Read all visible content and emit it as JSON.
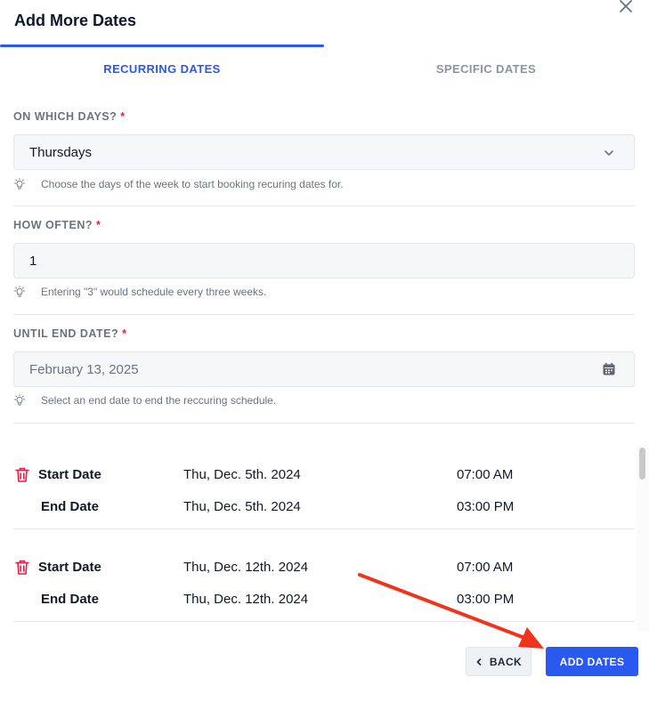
{
  "modal": {
    "title": "Add More Dates"
  },
  "tabs": [
    {
      "label": "RECURRING DATES",
      "active": true
    },
    {
      "label": "SPECIFIC DATES",
      "active": false
    }
  ],
  "form": {
    "days": {
      "label": "ON WHICH DAYS?",
      "required": "*",
      "value": "Thursdays",
      "hint": "Choose the days of the week to start booking recuring dates for."
    },
    "often": {
      "label": "HOW OFTEN?",
      "required": "*",
      "value": "1",
      "hint": "Entering \"3\" would schedule every three weeks."
    },
    "until": {
      "label": "UNTIL END DATE?",
      "required": "*",
      "placeholder": "February 13, 2025",
      "hint": "Select an end date to end the reccuring schedule."
    }
  },
  "dates": [
    {
      "start_label": "Start Date",
      "start_date": "Thu, Dec. 5th. 2024",
      "start_time": "07:00 AM",
      "end_label": "End Date",
      "end_date": "Thu, Dec. 5th. 2024",
      "end_time": "03:00 PM"
    },
    {
      "start_label": "Start Date",
      "start_date": "Thu, Dec. 12th. 2024",
      "start_time": "07:00 AM",
      "end_label": "End Date",
      "end_date": "Thu, Dec. 12th. 2024",
      "end_time": "03:00 PM"
    }
  ],
  "footer": {
    "back_label": "BACK",
    "add_label": "ADD DATES"
  },
  "colors": {
    "accent": "#2a59f0",
    "required": "#e11d48",
    "trash": "#e11d48",
    "annotation": "#f0331d"
  }
}
